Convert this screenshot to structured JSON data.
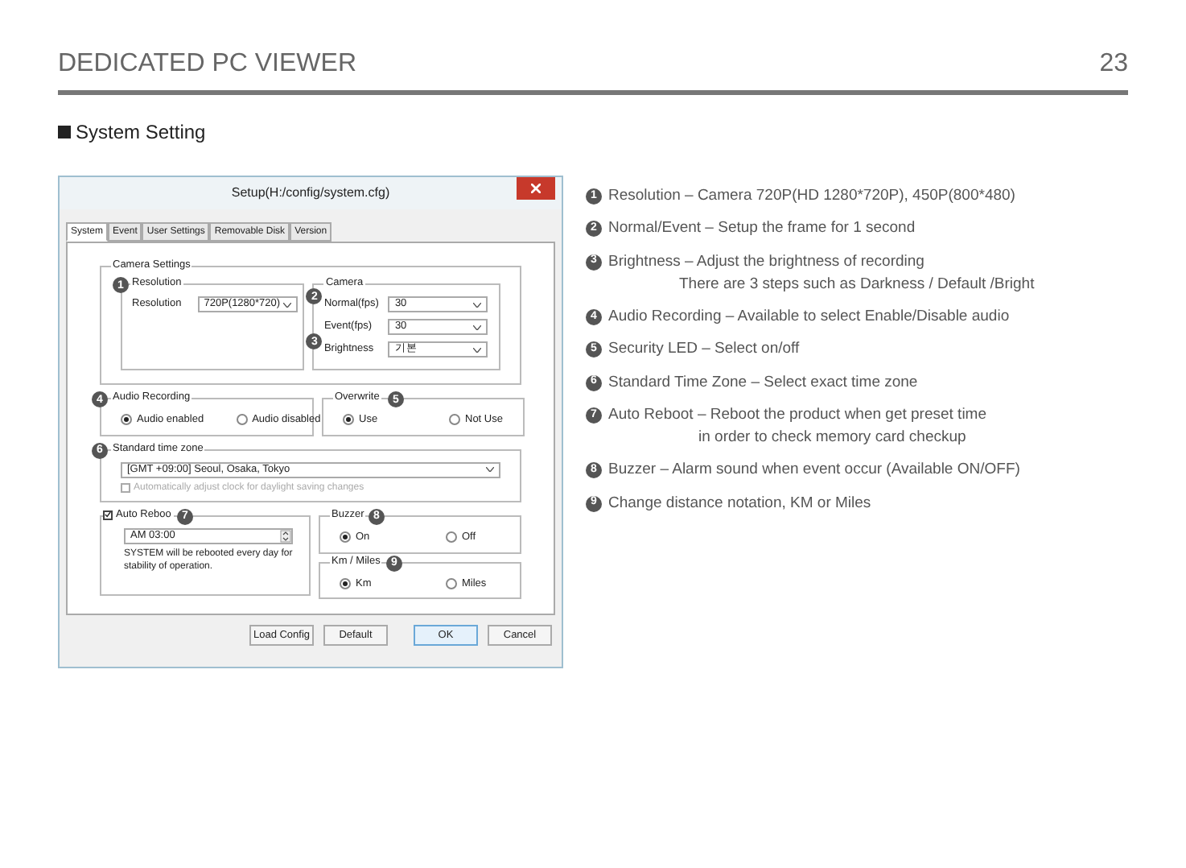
{
  "header": {
    "title": "DEDICATED PC VIEWER",
    "page": "23"
  },
  "section_title": "System Setting",
  "dialog": {
    "title": "Setup(H:/config/system.cfg)",
    "tabs": [
      {
        "label": "System",
        "selected": true
      },
      {
        "label": "Event",
        "selected": false
      },
      {
        "label": "User Settings",
        "selected": false
      },
      {
        "label": "Removable Disk",
        "selected": false
      },
      {
        "label": "Version",
        "selected": false
      }
    ],
    "camera_settings": {
      "title": "Camera Settings",
      "resolution_group": {
        "title": "Resolution",
        "marker": "1",
        "label": "Resolution",
        "value": "720P(1280*720)"
      },
      "camera_group": {
        "title": "Camera",
        "fields": [
          {
            "label": "Normal(fps)",
            "value": "30",
            "marker": "2"
          },
          {
            "label": "Event(fps)",
            "value": "30"
          },
          {
            "label": "Brightness",
            "value": "기본",
            "marker": "3"
          }
        ]
      }
    },
    "audio": {
      "title": "Audio Recording",
      "marker": "4",
      "options": [
        {
          "label": "Audio enabled",
          "selected": true
        },
        {
          "label": "Audio disabled",
          "selected": false
        }
      ]
    },
    "overwrite": {
      "title": "Overwrite",
      "marker": "5",
      "options": [
        {
          "label": "Use",
          "selected": true
        },
        {
          "label": "Not Use",
          "selected": false
        }
      ]
    },
    "time_zone": {
      "title": "Standard time zone",
      "marker": "6",
      "value": "[GMT +09:00] Seoul, Osaka, Tokyo",
      "dst": {
        "label": "Automatically adjust clock for daylight saving changes",
        "checked": false,
        "disabled": true
      }
    },
    "auto_reboot": {
      "label": "Auto Reboo",
      "marker": "7",
      "checked": true,
      "value": "AM 03:00",
      "note": "SYSTEM will be rebooted every day for stability of operation."
    },
    "buzzer": {
      "title": "Buzzer",
      "marker": "8",
      "options": [
        {
          "label": "On",
          "selected": true
        },
        {
          "label": "Off",
          "selected": false
        }
      ]
    },
    "km_miles": {
      "title": "Km / Miles",
      "marker": "9",
      "options": [
        {
          "label": "Km",
          "selected": true
        },
        {
          "label": "Miles",
          "selected": false
        }
      ]
    },
    "buttons": [
      {
        "label": "Load Config",
        "primary": false
      },
      {
        "label": "Default",
        "primary": false
      },
      {
        "label": "OK",
        "primary": true
      },
      {
        "label": "Cancel",
        "primary": false
      }
    ]
  },
  "notes": [
    {
      "marker": "1",
      "text": "Resolution – Camera 720P(HD 1280*720P), 450P(800*480)"
    },
    {
      "marker": "2",
      "text": "Normal/Event – Setup the frame for 1 second"
    },
    {
      "marker": "3",
      "text": "Brightness – Adjust the brightness of recording",
      "continuation": "There are 3 steps such as Darkness / Default /Bright"
    },
    {
      "marker": "4",
      "text": "Audio Recording – Available to select Enable/Disable audio"
    },
    {
      "marker": "5",
      "text": "Security LED – Select on/off"
    },
    {
      "marker": "6",
      "text": "Standard Time Zone – Select exact time zone"
    },
    {
      "marker": "7",
      "text": "Auto Reboot – Reboot the product when get preset time",
      "continuation": "in order to check memory card checkup"
    },
    {
      "marker": "8",
      "text": "Buzzer – Alarm sound when event occur (Available ON/OFF)"
    },
    {
      "marker": "9",
      "text": "Change distance notation, KM or Miles"
    }
  ]
}
